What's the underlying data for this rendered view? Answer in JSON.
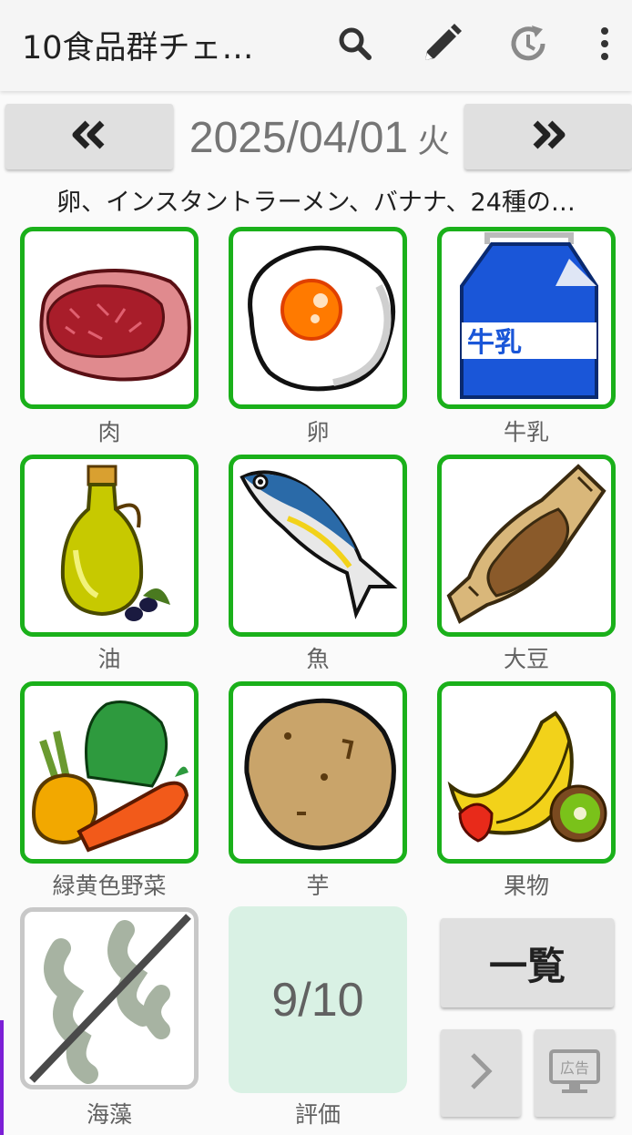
{
  "app": {
    "title": "10食品群チェ…",
    "actions": [
      "search-icon",
      "pencil-icon",
      "history-icon",
      "more-vert-icon"
    ]
  },
  "datebar": {
    "prev_icon": "double-chevron-left-icon",
    "next_icon": "double-chevron-right-icon",
    "date": "2025/04/01",
    "weekday": "火"
  },
  "summary": "卵、インスタントラーメン、バナナ、24種の…",
  "foods": [
    {
      "label": "肉",
      "icon": "meat-icon",
      "checked": true
    },
    {
      "label": "卵",
      "icon": "fried-egg-icon",
      "checked": true
    },
    {
      "label": "牛乳",
      "icon": "milk-carton-icon",
      "checked": true
    },
    {
      "label": "油",
      "icon": "olive-oil-icon",
      "checked": true
    },
    {
      "label": "魚",
      "icon": "fish-icon",
      "checked": true
    },
    {
      "label": "大豆",
      "icon": "natto-icon",
      "checked": true
    },
    {
      "label": "緑黄色野菜",
      "icon": "vegetables-icon",
      "checked": true
    },
    {
      "label": "芋",
      "icon": "potato-icon",
      "checked": true
    },
    {
      "label": "果物",
      "icon": "fruits-icon",
      "checked": true
    },
    {
      "label": "海藻",
      "icon": "seaweed-icon",
      "checked": false
    }
  ],
  "milk_text": "牛乳",
  "score": {
    "value": "9/10",
    "label": "評価"
  },
  "list_button": "一覧",
  "ad_label": "広告",
  "colors": {
    "checked_border": "#1ab01a",
    "unchecked_border": "#c8c8c8",
    "score_bg": "#d9f1e4"
  }
}
